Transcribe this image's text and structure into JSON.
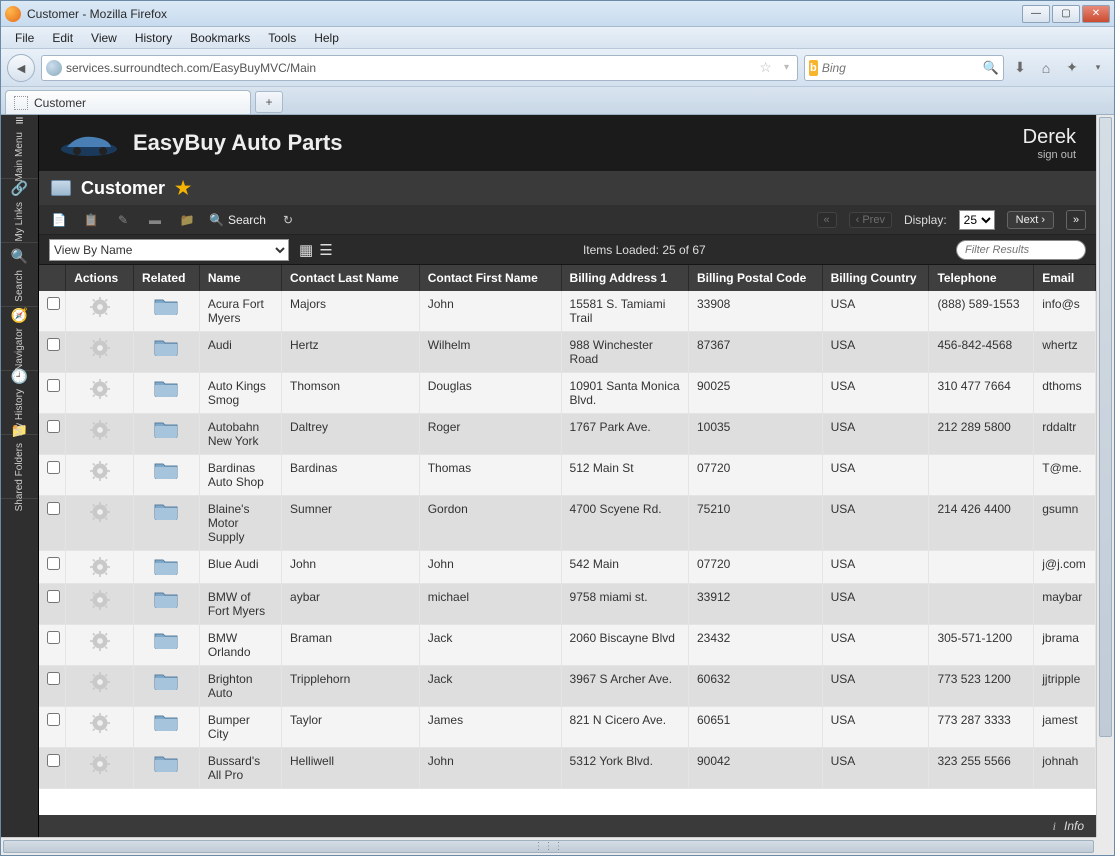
{
  "window": {
    "title": "Customer - Mozilla Firefox"
  },
  "menus": [
    "File",
    "Edit",
    "View",
    "History",
    "Bookmarks",
    "Tools",
    "Help"
  ],
  "url": "services.surroundtech.com/EasyBuyMVC/Main",
  "search_placeholder": "Bing",
  "tab": {
    "label": "Customer"
  },
  "rail": [
    {
      "label": "Main Menu",
      "icon": "≡"
    },
    {
      "label": "My Links",
      "icon": "🔗"
    },
    {
      "label": "Search",
      "icon": "🔍"
    },
    {
      "label": "Navigator",
      "icon": "🧭"
    },
    {
      "label": "My History",
      "icon": "🕘"
    },
    {
      "label": "Shared Folders",
      "icon": "📁"
    }
  ],
  "header": {
    "app_title": "EasyBuy Auto Parts",
    "user": "Derek",
    "signout": "sign out"
  },
  "page": {
    "title": "Customer"
  },
  "toolbar": {
    "search": "Search",
    "prev": "‹ Prev",
    "display_label": "Display:",
    "display_value": "25",
    "next": "Next ›"
  },
  "subbar": {
    "viewby": "View By Name",
    "items_loaded": "Items Loaded: 25 of 67",
    "filter_placeholder": "Filter Results"
  },
  "columns": [
    "",
    "Actions",
    "Related",
    "Name",
    "Contact Last Name",
    "Contact First Name",
    "Billing Address 1",
    "Billing Postal Code",
    "Billing Country",
    "Telephone",
    "Email"
  ],
  "rows": [
    {
      "name": "Acura Fort Myers",
      "cl": "Majors",
      "cf": "John",
      "addr": "15581 S. Tamiami Trail",
      "zip": "33908",
      "cty": "USA",
      "tel": "(888) 589-1553",
      "em": "info@s"
    },
    {
      "name": "Audi",
      "cl": "Hertz",
      "cf": "Wilhelm",
      "addr": "988 Winchester Road",
      "zip": "87367",
      "cty": "USA",
      "tel": "456-842-4568",
      "em": "whertz"
    },
    {
      "name": "Auto Kings Smog",
      "cl": "Thomson",
      "cf": "Douglas",
      "addr": "10901 Santa Monica Blvd.",
      "zip": "90025",
      "cty": "USA",
      "tel": "310 477 7664",
      "em": "dthoms"
    },
    {
      "name": "Autobahn New York",
      "cl": "Daltrey",
      "cf": "Roger",
      "addr": "1767 Park Ave.",
      "zip": "10035",
      "cty": "USA",
      "tel": "212 289 5800",
      "em": "rddaltr"
    },
    {
      "name": "Bardinas Auto Shop",
      "cl": "Bardinas",
      "cf": "Thomas",
      "addr": "512 Main St",
      "zip": "07720",
      "cty": "USA",
      "tel": "",
      "em": "T@me."
    },
    {
      "name": "Blaine's Motor Supply",
      "cl": "Sumner",
      "cf": "Gordon",
      "addr": "4700 Scyene Rd.",
      "zip": "75210",
      "cty": "USA",
      "tel": "214 426 4400",
      "em": "gsumn"
    },
    {
      "name": "Blue Audi",
      "cl": "John",
      "cf": "John",
      "addr": "542 Main",
      "zip": "07720",
      "cty": "USA",
      "tel": "",
      "em": "j@j.com"
    },
    {
      "name": "BMW of Fort Myers",
      "cl": "aybar",
      "cf": "michael",
      "addr": "9758 miami st.",
      "zip": "33912",
      "cty": "USA",
      "tel": "",
      "em": "maybar"
    },
    {
      "name": "BMW Orlando",
      "cl": "Braman",
      "cf": "Jack",
      "addr": "2060 Biscayne Blvd",
      "zip": "23432",
      "cty": "USA",
      "tel": "305-571-1200",
      "em": "jbrama"
    },
    {
      "name": "Brighton Auto",
      "cl": "Tripplehorn",
      "cf": "Jack",
      "addr": "3967 S Archer Ave.",
      "zip": "60632",
      "cty": "USA",
      "tel": "773 523 1200",
      "em": "jjtripple"
    },
    {
      "name": "Bumper City",
      "cl": "Taylor",
      "cf": "James",
      "addr": "821 N Cicero Ave.",
      "zip": "60651",
      "cty": "USA",
      "tel": "773 287 3333",
      "em": "jamest"
    },
    {
      "name": "Bussard's All Pro",
      "cl": "Helliwell",
      "cf": "John",
      "addr": "5312 York Blvd.",
      "zip": "90042",
      "cty": "USA",
      "tel": "323 255 5566",
      "em": "johnah"
    }
  ],
  "info": "Info"
}
